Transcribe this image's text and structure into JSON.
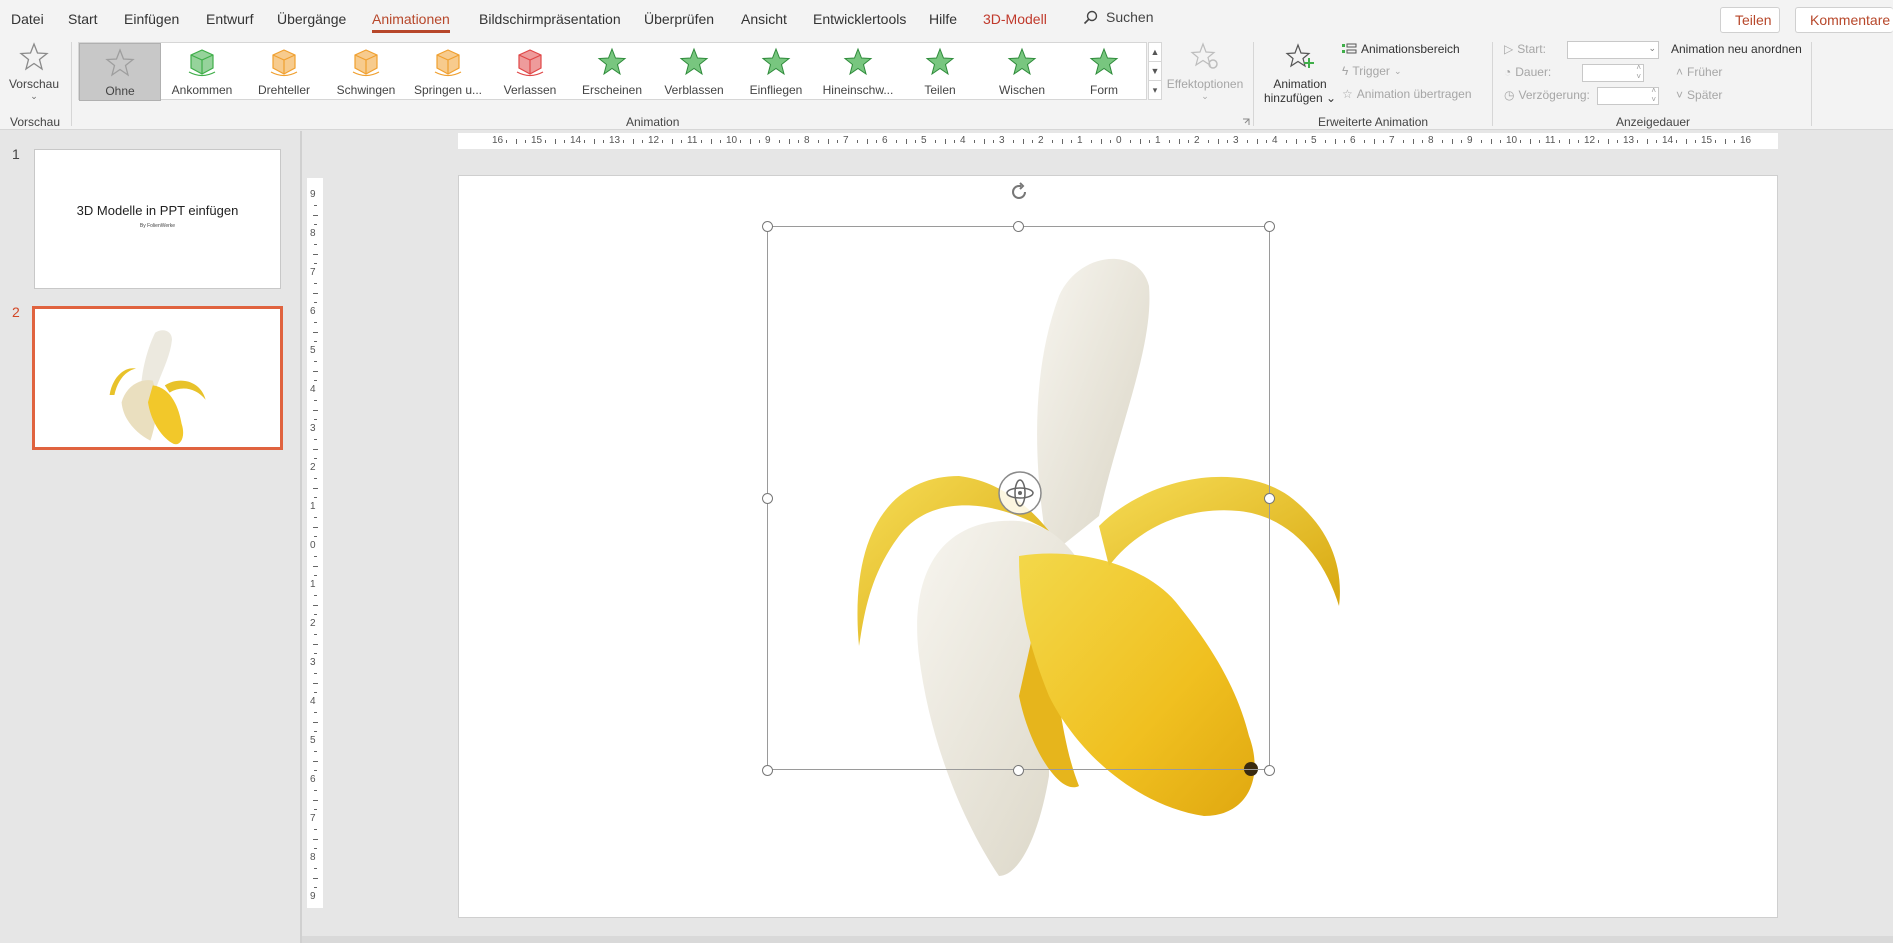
{
  "menu": {
    "items": [
      "Datei",
      "Start",
      "Einfügen",
      "Entwurf",
      "Übergänge",
      "Animationen",
      "Bildschirmpräsentation",
      "Überprüfen",
      "Ansicht",
      "Entwicklertools",
      "Hilfe",
      "3D-Modell"
    ],
    "active": "Animationen",
    "search_label": "Suchen",
    "share_label": "Teilen",
    "comments_label": "Kommentare"
  },
  "ribbon": {
    "preview": {
      "label": "Vorschau",
      "group_label": "Vorschau"
    },
    "gallery": [
      {
        "label": "Ohne",
        "icon": "star-outline-icon",
        "color": "#9e9e9e"
      },
      {
        "label": "Ankommen",
        "icon": "cube-arrive-icon",
        "color": "#3fae49"
      },
      {
        "label": "Drehteller",
        "icon": "cube-turntable-icon",
        "color": "#f0a030"
      },
      {
        "label": "Schwingen",
        "icon": "cube-swing-icon",
        "color": "#f0a030"
      },
      {
        "label": "Springen u...",
        "icon": "cube-jump-icon",
        "color": "#f0a030"
      },
      {
        "label": "Verlassen",
        "icon": "cube-leave-icon",
        "color": "#e04848"
      },
      {
        "label": "Erscheinen",
        "icon": "star-appear-icon",
        "color": "#3fae49"
      },
      {
        "label": "Verblassen",
        "icon": "star-fade-icon",
        "color": "#3fae49"
      },
      {
        "label": "Einfliegen",
        "icon": "star-flyin-icon",
        "color": "#3fae49"
      },
      {
        "label": "Hineinschw...",
        "icon": "star-swivel-icon",
        "color": "#3fae49"
      },
      {
        "label": "Teilen",
        "icon": "star-split-icon",
        "color": "#3fae49"
      },
      {
        "label": "Wischen",
        "icon": "star-wipe-icon",
        "color": "#3fae49"
      },
      {
        "label": "Form",
        "icon": "star-shape-icon",
        "color": "#3fae49"
      }
    ],
    "effect_options_label": "Effektoptionen",
    "animation_group_label": "Animation",
    "add_animation_label_1": "Animation",
    "add_animation_label_2": "hinzufügen",
    "animation_pane_label": "Animationsbereich",
    "trigger_label": "Trigger",
    "painter_label": "Animation übertragen",
    "advanced_group_label": "Erweiterte Animation",
    "start_label": "Start:",
    "duration_label": "Dauer:",
    "delay_label": "Verzögerung:",
    "reorder_label": "Animation neu anordnen",
    "earlier_label": "Früher",
    "later_label": "Später",
    "timing_group_label": "Anzeigedauer"
  },
  "slides": [
    {
      "number": "1",
      "title": "3D Modelle in PPT einfügen",
      "subtitle": "By FolienWerke"
    },
    {
      "number": "2",
      "title": "",
      "subtitle": ""
    }
  ],
  "selected_slide": "2",
  "ruler": {
    "h_labels": [
      "16",
      "15",
      "14",
      "13",
      "12",
      "11",
      "10",
      "9",
      "8",
      "7",
      "6",
      "5",
      "4",
      "3",
      "2",
      "1",
      "0",
      "1",
      "2",
      "3",
      "4",
      "5",
      "6",
      "7",
      "8",
      "9",
      "10",
      "11",
      "12",
      "13",
      "14",
      "15",
      "16"
    ],
    "v_labels": [
      "9",
      "8",
      "7",
      "6",
      "5",
      "4",
      "3",
      "2",
      "1",
      "0",
      "1",
      "2",
      "3",
      "4",
      "5",
      "6",
      "7",
      "8",
      "9"
    ]
  },
  "colors": {
    "accent": "#b7472a",
    "highlight": "#fff200",
    "selection": "#e0633f"
  }
}
